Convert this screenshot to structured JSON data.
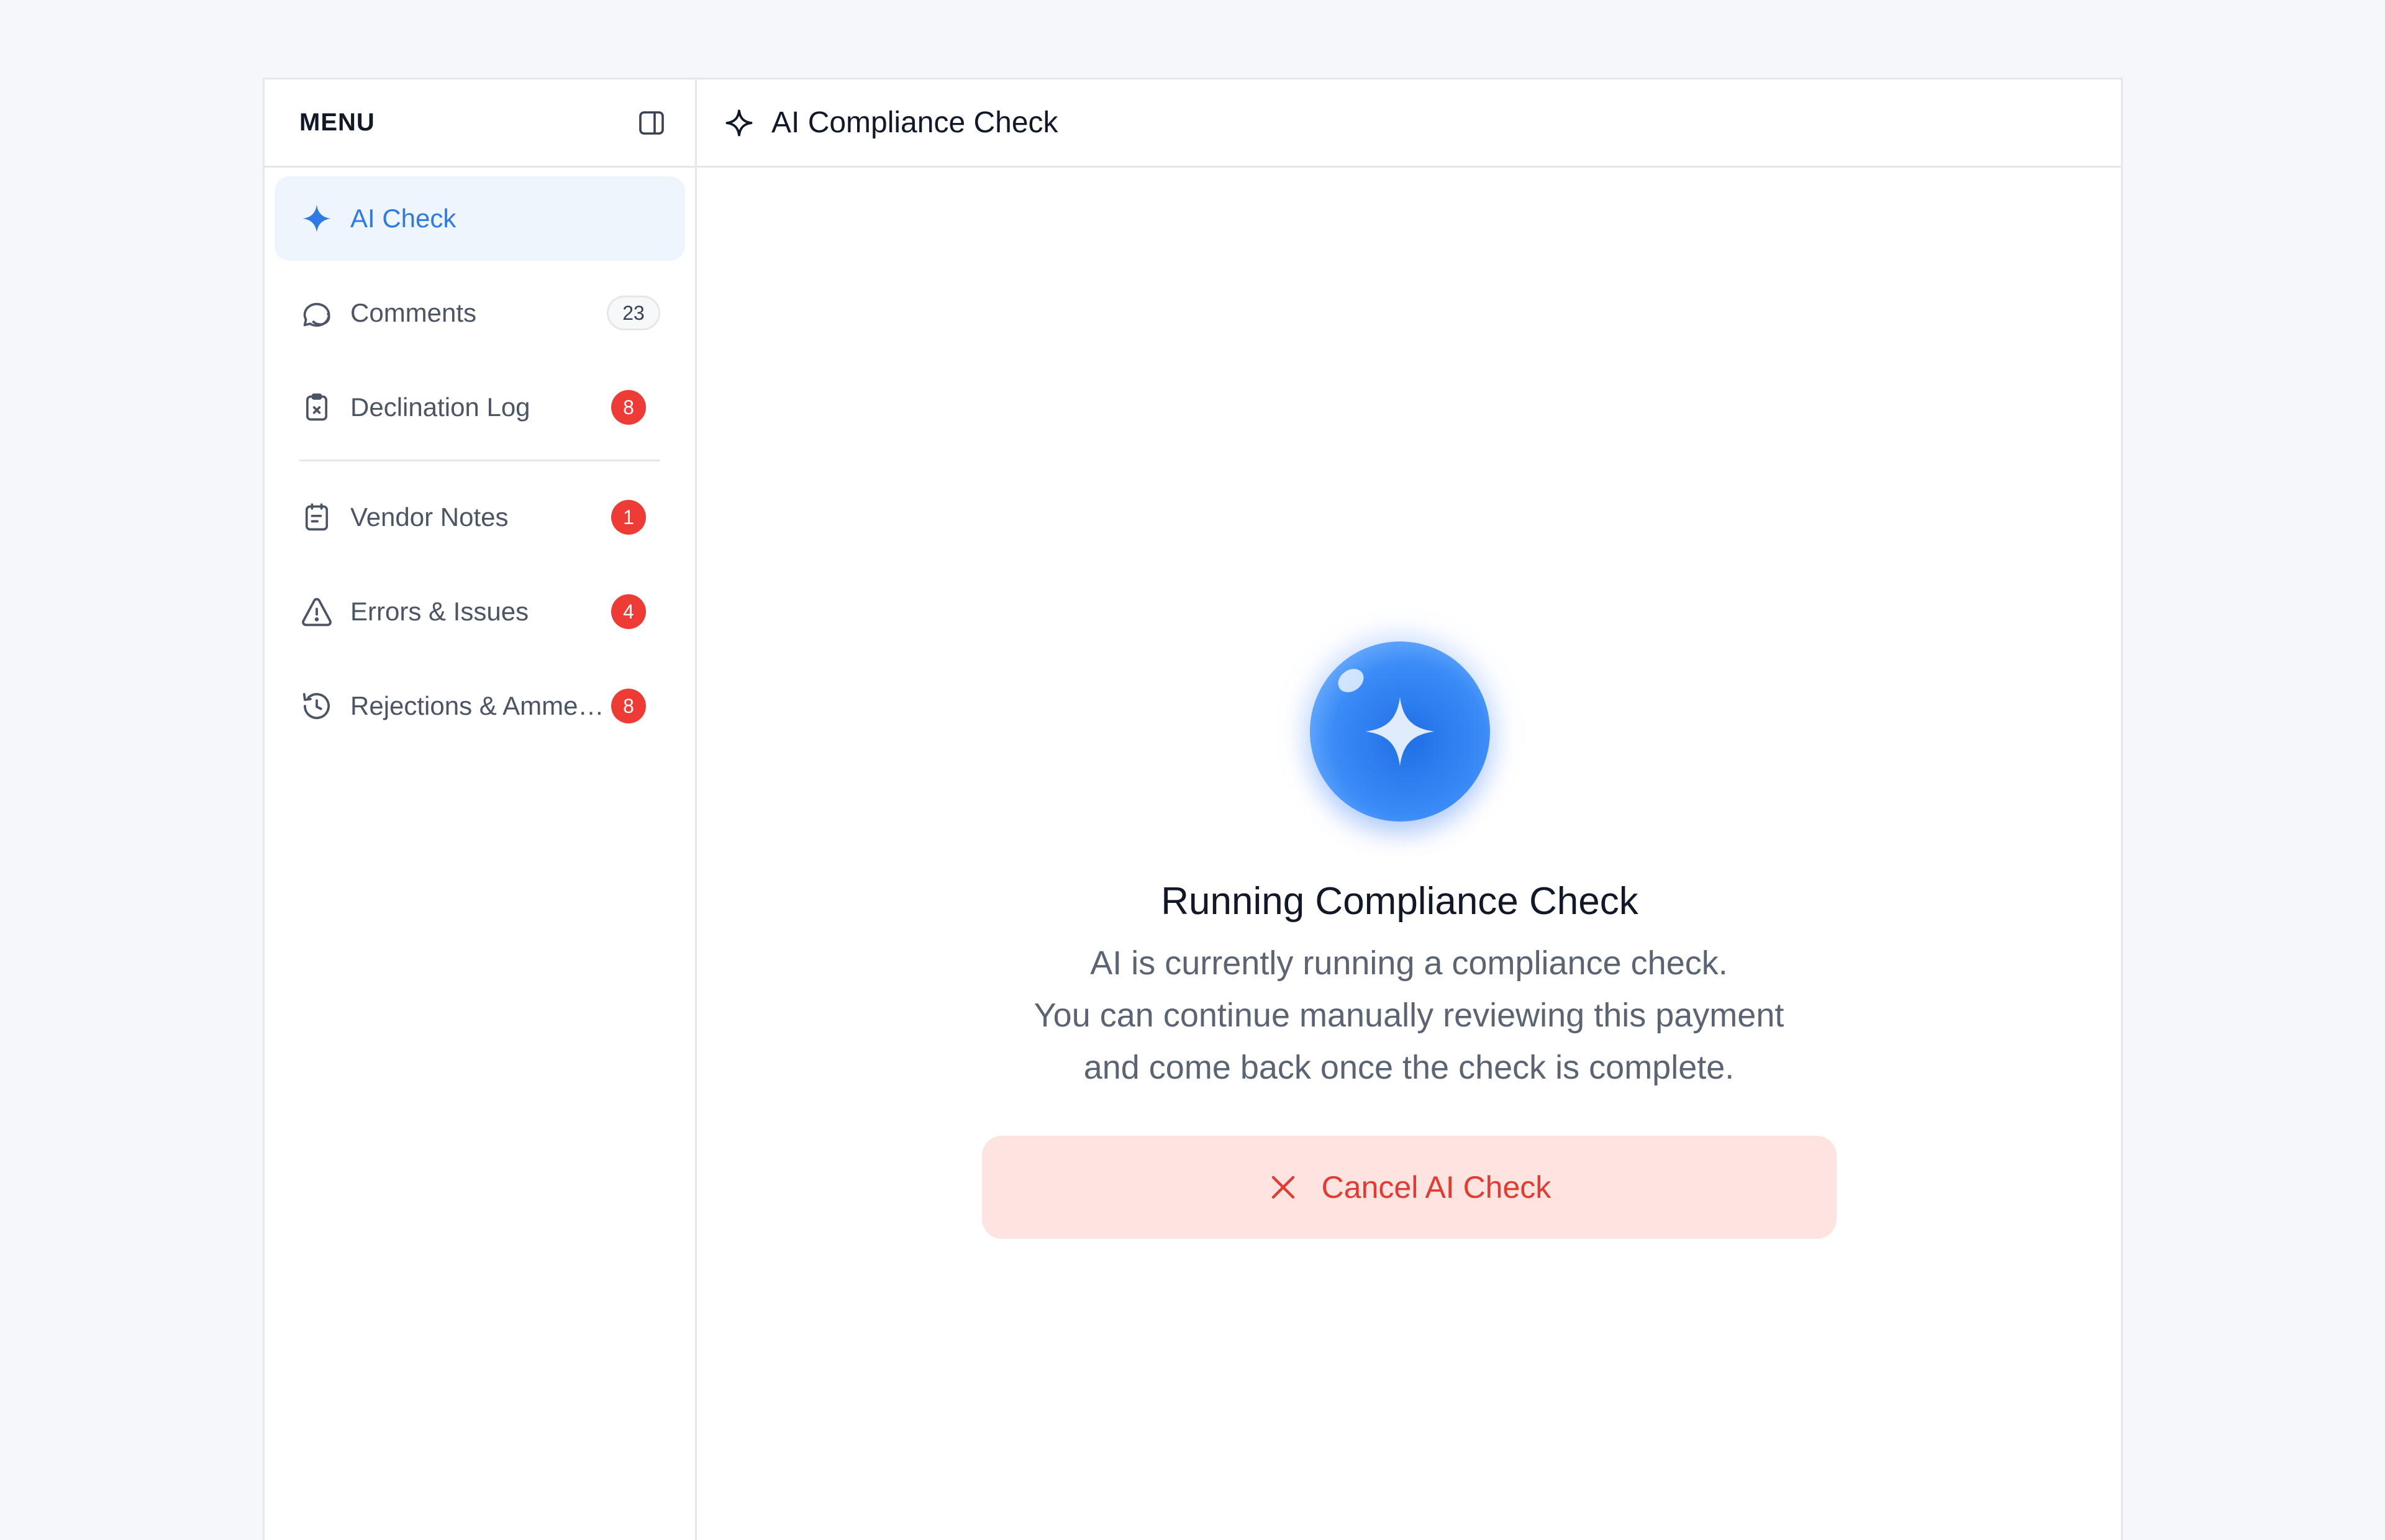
{
  "sidebar": {
    "title": "MENU",
    "items": [
      {
        "label": "AI Check",
        "badge": null,
        "icon": "sparkle-icon"
      },
      {
        "label": "Comments",
        "badge": "23",
        "icon": "comment-icon"
      },
      {
        "label": "Declination Log",
        "badge": "8",
        "icon": "clipboard-x-icon"
      },
      {
        "label": "Vendor Notes",
        "badge": "1",
        "icon": "notes-icon"
      },
      {
        "label": "Errors & Issues",
        "badge": "4",
        "icon": "warning-icon"
      },
      {
        "label": "Rejections & Ammendments",
        "badge": "8",
        "icon": "history-icon"
      }
    ]
  },
  "main": {
    "title": "AI Compliance Check",
    "status_title": "Running Compliance Check",
    "status_lines": [
      "AI is currently running a compliance check.",
      "You can continue manually reviewing this payment",
      "and come back once the check is complete."
    ],
    "cancel_label": "Cancel AI Check"
  },
  "colors": {
    "accent": "#2f7be6",
    "badge_red": "#ef3b36",
    "cancel_bg": "#fde4e1",
    "cancel_text": "#e53a2f"
  }
}
